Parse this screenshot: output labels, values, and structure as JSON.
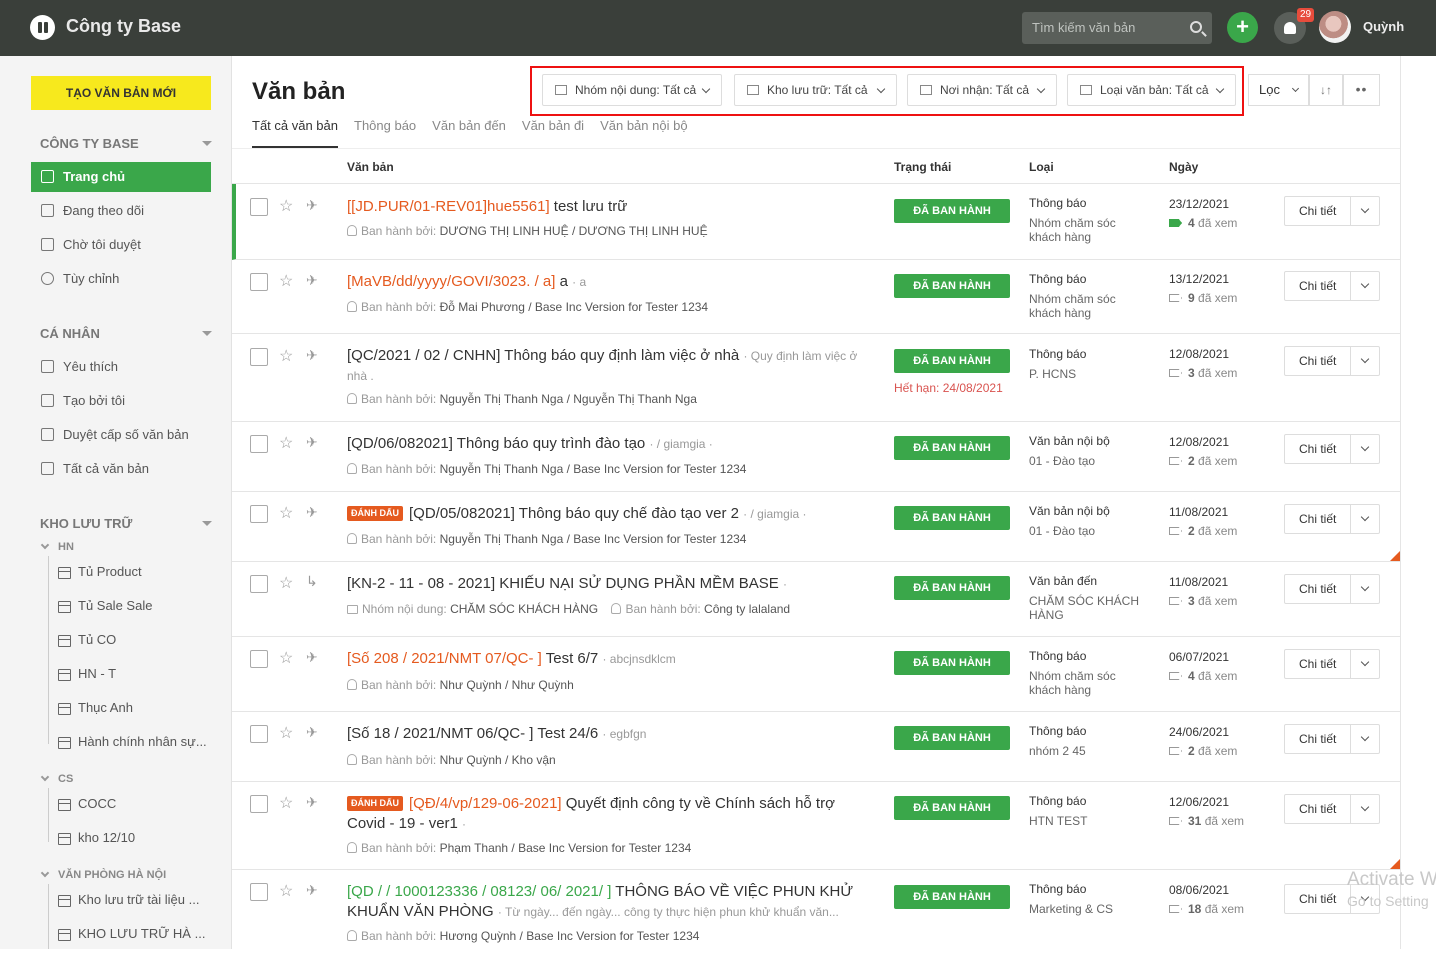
{
  "topbar": {
    "brand": "Công ty Base",
    "search_placeholder": "Tìm kiếm văn bản",
    "notif_count": "29",
    "user_name": "Quỳnh"
  },
  "sidebar": {
    "new_doc": "TẠO VĂN BẢN MỚI",
    "sec_company": "CÔNG TY BASE",
    "company_items": [
      "Trang chủ",
      "Đang theo dõi",
      "Chờ tôi duyệt",
      "Tùy chỉnh"
    ],
    "sec_personal": "CÁ NHÂN",
    "personal_items": [
      "Yêu thích",
      "Tạo bởi tôi",
      "Duyệt cấp số văn bản",
      "Tất cả văn bản"
    ],
    "sec_storage": "KHO LƯU TRỮ",
    "groups": [
      {
        "name": "HN",
        "items": [
          "Tủ Product",
          "Tủ Sale Sale",
          "Tủ CO",
          "HN - T",
          "Thục Anh",
          "Hành chính nhân sự..."
        ]
      },
      {
        "name": "CS",
        "items": [
          "COCC",
          "kho 12/10"
        ]
      },
      {
        "name": "VĂN PHÒNG HÀ NỘI",
        "items": [
          "Kho lưu trữ tài liệu ...",
          "KHO LƯU TRỮ HÀ ..."
        ]
      }
    ]
  },
  "main": {
    "title": "Văn bản",
    "tabs": [
      "Tất cả văn bản",
      "Thông báo",
      "Văn bản đến",
      "Văn bản đi",
      "Văn bản nội bộ"
    ],
    "filters": [
      "Nhóm nội dung: Tất cả",
      "Kho lưu trữ: Tất cả",
      "Nơi nhận: Tất cả",
      "Loại văn bản: Tất cả"
    ],
    "filter_label": "Lọc",
    "headers": {
      "doc": "Văn bản",
      "status": "Trạng thái",
      "type": "Loại",
      "date": "Ngày"
    },
    "detail_label": "Chi tiết",
    "rows": [
      {
        "code": "[[JD.PUR/01-REV01]hue5561]",
        "title": "test lưu trữ",
        "sub": "",
        "issuer": "DƯƠNG THỊ LINH HUỆ / DƯƠNG THỊ LINH HUỆ",
        "status": "ĐÃ BAN HÀNH",
        "type": "Thông báo",
        "type2": "Nhóm chăm sóc khách hàng",
        "date": "23/12/2021",
        "seen": "4",
        "seen_label": "đã xem"
      },
      {
        "code": "[MaVB/dd/yyyy/GOVI/3023. / a]",
        "title": "a",
        "sub": "· a",
        "issuer": "Đỗ Mai Phương / Base Inc Version for Tester 1234",
        "status": "ĐÃ BAN HÀNH",
        "type": "Thông báo",
        "type2": "Nhóm chăm sóc khách hàng",
        "date": "13/12/2021",
        "seen": "9",
        "seen_label": "đã xem"
      },
      {
        "title": "[QC/2021 / 02 / CNHN] Thông báo quy định làm việc ở nhà",
        "sub": "· Quy định làm việc ở nhà .",
        "issuer": "Nguyễn Thị Thanh Nga / Nguyễn Thị Thanh Nga",
        "status": "ĐÃ BAN HÀNH",
        "expire": "Hết hạn: 24/08/2021",
        "type": "Thông báo",
        "type2": "P. HCNS",
        "date": "12/08/2021",
        "seen": "3",
        "seen_label": "đã xem"
      },
      {
        "title": "[QD/06/082021] Thông báo quy trình đào tạo",
        "sub": "· / giamgia ·",
        "issuer": "Nguyễn Thị Thanh Nga / Base Inc Version for Tester 1234",
        "status": "ĐÃ BAN HÀNH",
        "type": "Văn bản nội bộ",
        "type2": "01 - Đào tạo",
        "date": "12/08/2021",
        "seen": "2",
        "seen_label": "đã xem"
      },
      {
        "mark": "ĐÁNH DẤU",
        "title": "[QD/05/082021] Thông báo quy chế đào tạo ver 2",
        "sub": "· / giamgia ·",
        "issuer": "Nguyễn Thị Thanh Nga / Base Inc Version for Tester 1234",
        "status": "ĐÃ BAN HÀNH",
        "type": "Văn bản nội bộ",
        "type2": "01 - Đào tạo",
        "date": "11/08/2021",
        "seen": "2",
        "seen_label": "đã xem"
      },
      {
        "title": "[KN-2 - 11 - 08 - 2021] KHIẾU NẠI SỬ DỤNG PHẦN MỀM BASE",
        "sub": "·",
        "group_label": "Nhóm nội dung:",
        "group": "CHĂM SÓC KHÁCH HÀNG",
        "issuer": "Công ty lalaland",
        "status": "ĐÃ BAN HÀNH",
        "type": "Văn bản đến",
        "type2": "CHĂM SÓC KHÁCH HÀNG",
        "date": "11/08/2021",
        "seen": "3",
        "seen_label": "đã xem"
      },
      {
        "code": "[Số 208 / 2021/NMT 07/QC- ]",
        "title": "Test 6/7",
        "sub": "· abcjnsdklcm",
        "issuer": "Như Quỳnh / Như Quỳnh",
        "status": "ĐÃ BAN HÀNH",
        "type": "Thông báo",
        "type2": "Nhóm chăm sóc khách hàng",
        "date": "06/07/2021",
        "seen": "4",
        "seen_label": "đã xem"
      },
      {
        "title": "[Số 18 / 2021/NMT 06/QC- ] Test 24/6",
        "sub": "· egbfgn",
        "issuer": "Như Quỳnh / Kho vận",
        "status": "ĐÃ BAN HÀNH",
        "type": "Thông báo",
        "type2": "nhóm 2 45",
        "date": "24/06/2021",
        "seen": "2",
        "seen_label": "đã xem"
      },
      {
        "mark": "ĐÁNH DẤU",
        "code": "[QĐ/4/vp/129-06-2021]",
        "title": "Quyết định công ty về Chính sách hỗ trợ Covid - 19 - ver1",
        "sub": "·",
        "issuer": "Phạm Thanh / Base Inc Version for Tester 1234",
        "status": "ĐÃ BAN HÀNH",
        "type": "Thông báo",
        "type2": "HTN TEST",
        "date": "12/06/2021",
        "seen": "31",
        "seen_label": "đã xem"
      },
      {
        "code": "[QD / / 1000123336 / 08123/ 06/ 2021/ ]",
        "title": "THÔNG BÁO VỀ VIỆC PHUN KHỬ KHUẨN VĂN PHÒNG",
        "sub": "· Từ ngày... đến ngày... công ty thực hiện phun khử khuẩn văn...",
        "issuer": "Hương Quỳnh / Base Inc Version for Tester 1234",
        "status": "ĐÃ BAN HÀNH",
        "type": "Thông báo",
        "type2": "Marketing & CS",
        "date": "08/06/2021",
        "seen": "18",
        "seen_label": "đã xem"
      }
    ],
    "issuer_label": "Ban hành bởi:"
  },
  "watermark": {
    "line1": "Activate W",
    "line2": "Go to Setting"
  },
  "colors": {
    "accent": "#3aa74a",
    "topbar": "#3a3f3a",
    "highlight": "#e55a1f",
    "new_button": "#f7e91d"
  }
}
